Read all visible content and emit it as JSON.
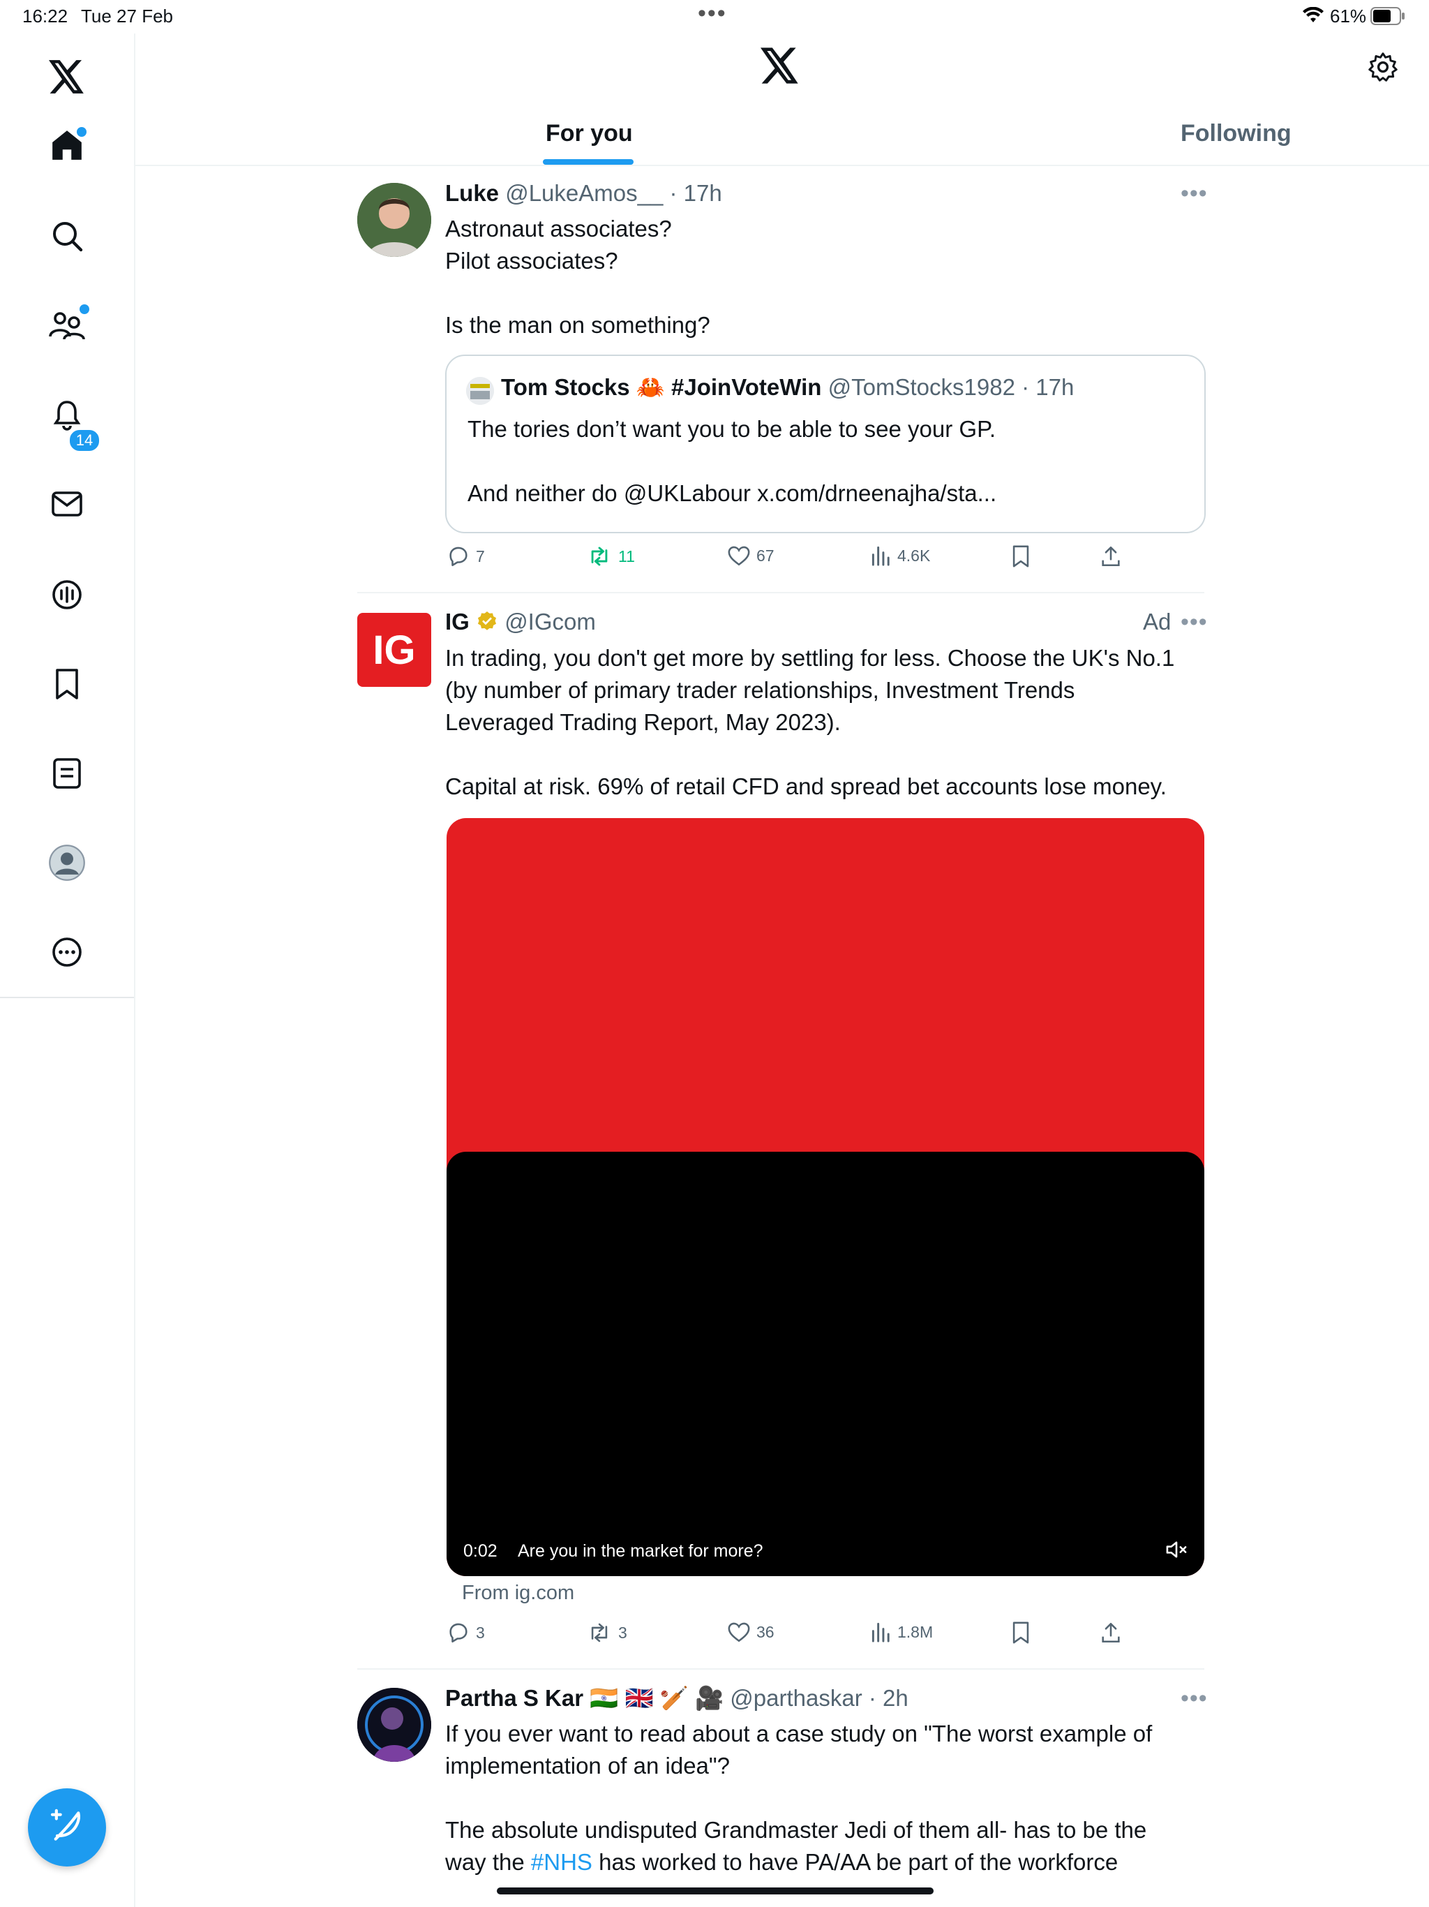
{
  "status_bar": {
    "time": "16:22",
    "date": "Tue 27 Feb",
    "battery": "61%"
  },
  "sidebar": {
    "items": [
      {
        "name": "x-logo-icon"
      },
      {
        "name": "home-icon",
        "unread_dot": true
      },
      {
        "name": "search-icon"
      },
      {
        "name": "communities-icon",
        "unread_dot": true
      },
      {
        "name": "notifications-icon",
        "badge": "14"
      },
      {
        "name": "messages-icon"
      },
      {
        "name": "spaces-icon"
      },
      {
        "name": "bookmarks-icon"
      },
      {
        "name": "lists-icon"
      },
      {
        "name": "profile-icon"
      },
      {
        "name": "more-icon"
      }
    ],
    "compose": {
      "name": "compose-icon"
    }
  },
  "header": {
    "tabs": [
      {
        "label": "For you",
        "active": true
      },
      {
        "label": "Following",
        "active": false
      }
    ]
  },
  "tweets": [
    {
      "name": "Luke",
      "handle": "@LukeAmos__",
      "time": "17h",
      "text_lines": [
        "Astronaut associates?",
        "Pilot associates?",
        "",
        "Is the man on something?"
      ],
      "quote": {
        "name": "Tom Stocks 🦀 #JoinVoteWin",
        "handle": "@TomStocks1982",
        "time": "17h",
        "line1": "The tories don’t want you to be able to see your GP.",
        "line2": "And neither do @UKLabour x.com/drneenajha/sta..."
      },
      "replies": "7",
      "reposts": "11",
      "likes": "67",
      "views": "4.6K"
    },
    {
      "name": "IG",
      "handle": "@IGcom",
      "ad_label": "Ad",
      "logo_text": "IG",
      "text_lines": [
        "In trading, you don't get more by settling for less. Choose the UK's No.1",
        "(by number of primary trader relationships, Investment Trends",
        "Leveraged Trading Report, May 2023).",
        "",
        "Capital at risk. 69% of retail CFD and spread bet accounts lose money."
      ],
      "video": {
        "time": "0:02",
        "caption": "Are you in the market for more?",
        "top_color": "#e41e22"
      },
      "source": "From ig.com",
      "replies": "3",
      "reposts": "3",
      "likes": "36",
      "views": "1.8M"
    },
    {
      "name": "Partha S Kar 🇮🇳 🇬🇧 🏏 🎥",
      "handle": "@parthaskar",
      "time": "2h",
      "text_lines": [
        "If you ever want to read about a case study on \"The worst example of",
        "implementation of an idea\"?",
        "",
        "The absolute undisputed Grandmaster Jedi of them all- has to be the"
      ],
      "last_line": {
        "before": "way the ",
        "hashtag": "#NHS",
        "after": " has worked to have PA/AA be part of the workforce"
      }
    }
  ],
  "colors": {
    "accent": "#1d9bf0",
    "repost_active": "#00ba7c",
    "ig_red": "#e41e22",
    "text_secondary": "#536471"
  }
}
